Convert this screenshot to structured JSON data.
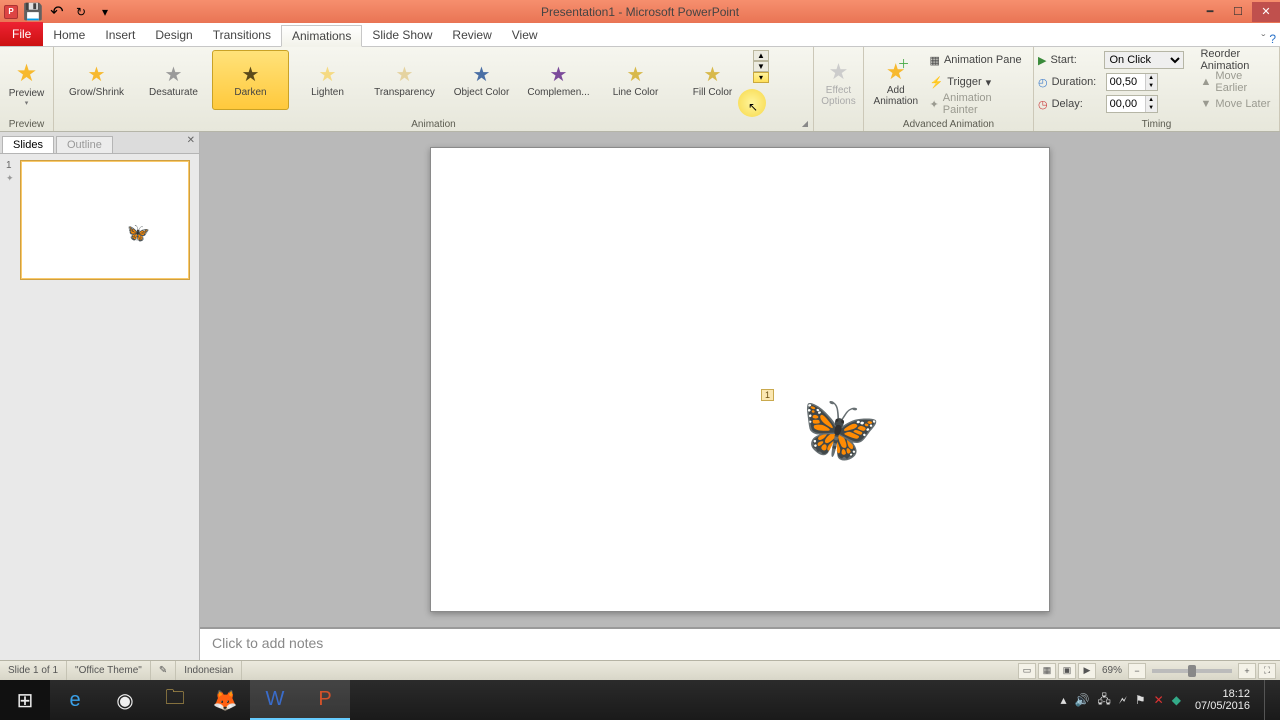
{
  "title": "Presentation1 - Microsoft PowerPoint",
  "tabs": {
    "file": "File",
    "items": [
      "Home",
      "Insert",
      "Design",
      "Transitions",
      "Animations",
      "Slide Show",
      "Review",
      "View"
    ],
    "active": "Animations"
  },
  "ribbon": {
    "preview": {
      "label": "Preview",
      "group": "Preview"
    },
    "gallery": {
      "group": "Animation",
      "items": [
        "Grow/Shrink",
        "Desaturate",
        "Darken",
        "Lighten",
        "Transparency",
        "Object Color",
        "Complemen...",
        "Line Color",
        "Fill Color"
      ],
      "selected": "Darken"
    },
    "effect_options": "Effect\nOptions",
    "advanced": {
      "group": "Advanced Animation",
      "add_animation": "Add\nAnimation",
      "animation_pane": "Animation Pane",
      "trigger": "Trigger",
      "animation_painter": "Animation Painter"
    },
    "timing": {
      "group": "Timing",
      "start_label": "Start:",
      "start_value": "On Click",
      "duration_label": "Duration:",
      "duration_value": "00,50",
      "delay_label": "Delay:",
      "delay_value": "00,00",
      "reorder": "Reorder Animation",
      "move_earlier": "Move Earlier",
      "move_later": "Move Later"
    }
  },
  "left_pane": {
    "tabs": [
      "Slides",
      "Outline"
    ],
    "active": "Slides",
    "slide_num": "1"
  },
  "slide": {
    "anim_tag": "1"
  },
  "notes_placeholder": "Click to add notes",
  "statusbar": {
    "slide": "Slide 1 of 1",
    "theme": "\"Office Theme\"",
    "language": "Indonesian",
    "zoom": "69%"
  },
  "systray": {
    "time": "18:12",
    "date": "07/05/2016"
  }
}
